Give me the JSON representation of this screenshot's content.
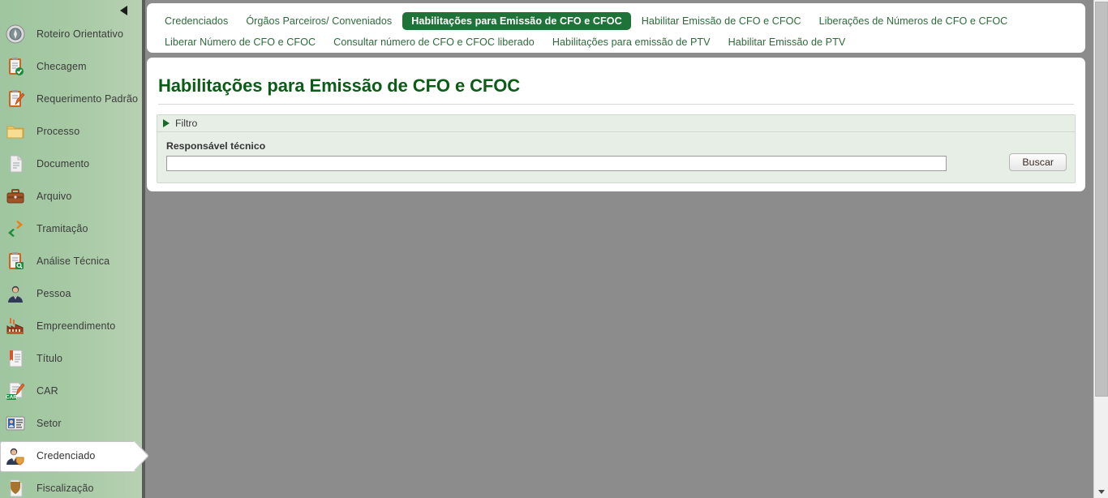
{
  "sidebar": {
    "collapse_icon": "collapse-left-arrow-icon",
    "items": [
      {
        "label": "Roteiro Orientativo",
        "icon": "compass-icon",
        "active": false
      },
      {
        "label": "Checagem",
        "icon": "clipboard-check-icon",
        "active": false
      },
      {
        "label": "Requerimento Padrão",
        "icon": "clipboard-pencil-icon",
        "active": false
      },
      {
        "label": "Processo",
        "icon": "folder-icon",
        "active": false
      },
      {
        "label": "Documento",
        "icon": "document-icon",
        "active": false
      },
      {
        "label": "Arquivo",
        "icon": "briefcase-icon",
        "active": false
      },
      {
        "label": "Tramitação",
        "icon": "arrows-loop-icon",
        "active": false
      },
      {
        "label": "Análise Técnica",
        "icon": "clipboard-search-icon",
        "active": false
      },
      {
        "label": "Pessoa",
        "icon": "person-icon",
        "active": false
      },
      {
        "label": "Empreendimento",
        "icon": "factory-icon",
        "active": false
      },
      {
        "label": "Título",
        "icon": "certificate-icon",
        "active": false
      },
      {
        "label": "CAR",
        "icon": "car-document-icon",
        "active": false
      },
      {
        "label": "Setor",
        "icon": "id-card-icon",
        "active": false
      },
      {
        "label": "Credenciado",
        "icon": "person-shield-icon",
        "active": true
      },
      {
        "label": "Fiscalização",
        "icon": "shield-icon",
        "active": false
      }
    ]
  },
  "tabs": {
    "row1": [
      {
        "label": "Credenciados",
        "active": false
      },
      {
        "label": "Órgãos Parceiros/ Conveniados",
        "active": false
      },
      {
        "label": "Habilitações para Emissão de CFO e CFOC",
        "active": true
      },
      {
        "label": "Habilitar Emissão de CFO e CFOC",
        "active": false
      },
      {
        "label": "Liberações de Números de CFO e CFOC",
        "active": false
      }
    ],
    "row2": [
      {
        "label": "Liberar Número de CFO e CFOC",
        "active": false
      },
      {
        "label": "Consultar número de CFO e CFOC liberado",
        "active": false
      },
      {
        "label": "Habilitações para emissão de PTV",
        "active": false
      },
      {
        "label": "Habilitar Emissão de PTV",
        "active": false
      }
    ]
  },
  "page": {
    "title": "Habilitações para Emissão de CFO e CFOC"
  },
  "filter": {
    "header_label": "Filtro",
    "expand_icon": "caret-right-icon",
    "field_label": "Responsável técnico",
    "field_value": "",
    "field_placeholder": "",
    "search_button": "Buscar"
  },
  "colors": {
    "accent_green": "#1f7339",
    "title_green": "#0b5c17",
    "link_green": "#2c6b39",
    "sidebar_green": "#a6c9a4",
    "filter_bg": "#e6eee6",
    "page_bg": "#8c8c8c"
  },
  "scrollbar": {
    "down_icon": "scroll-down-arrow-icon"
  }
}
